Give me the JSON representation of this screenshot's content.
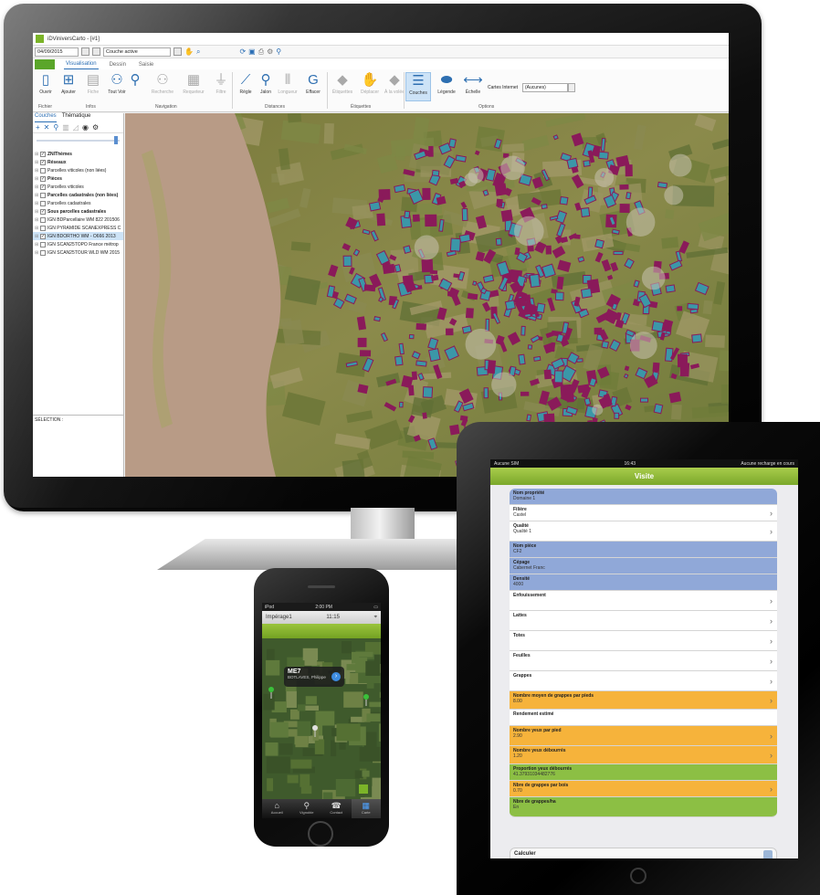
{
  "desktop": {
    "window_title": "iDViniversCarto - [#1]",
    "quickbar": {
      "date": "04/09/2015",
      "layer_combo": "Couche active"
    },
    "ribbon_tabs": [
      "Visualisation",
      "Dessin",
      "Saisie"
    ],
    "ribbon": {
      "buttons": {
        "ouvrir": "Ouvrir",
        "ajouter": "Ajouter",
        "fiche": "Fiche",
        "tout_voir": "Tout Voir",
        "recherche": "Recherche",
        "requeteur": "Requeteur",
        "filtre": "Filtre",
        "regle": "Règle",
        "jalon": "Jalon",
        "longueur": "Longueur",
        "effacer": "Effacer",
        "etiquettes": "Étiquettes",
        "deplacer": "Déplacer",
        "a_la_volee": "À la volée",
        "couches": "Couches",
        "legende": "Légende",
        "echelle": "Échelle"
      },
      "groups": {
        "fichier": "Fichier",
        "infos": "Infos",
        "navigation": "Navigation",
        "distances": "Distances",
        "etiquettes": "Étiquettes",
        "options": "Options"
      },
      "cartes_internet_label": "Cartes Internet",
      "cartes_internet_value": "(Aucunes)"
    },
    "left_panel": {
      "tabs": [
        "Couches",
        "Thématique"
      ],
      "layers": [
        {
          "name": "ZNIThèmes",
          "checked": true,
          "bold": true
        },
        {
          "name": "Réseaux",
          "checked": true,
          "bold": true
        },
        {
          "name": "Parcelles viticoles (non liées)",
          "checked": false,
          "bold": false
        },
        {
          "name": "Pièces",
          "checked": true,
          "bold": true
        },
        {
          "name": "Parcelles viticoles",
          "checked": true,
          "bold": false
        },
        {
          "name": "Parcelles cadastrales (non liées)",
          "checked": false,
          "bold": true
        },
        {
          "name": "Parcelles cadastrales",
          "checked": false,
          "bold": false
        },
        {
          "name": "Sous parcelles cadastrales",
          "checked": true,
          "bold": true
        },
        {
          "name": "IGN BDParcellaire WM 822 201506",
          "checked": false,
          "bold": false
        },
        {
          "name": "IGN PYRAMIDE SCANEXPRESS C",
          "checked": false,
          "bold": false
        },
        {
          "name": "IGN BDORTHO WM - O666 2013",
          "checked": true,
          "bold": false
        },
        {
          "name": "IGN SCAN25TOPO France métrop",
          "checked": false,
          "bold": false
        },
        {
          "name": "IGN SCAN25TOUR WLD WM 2015",
          "checked": false,
          "bold": false
        }
      ],
      "selection_label": "SÉLECTION :"
    },
    "colors": {
      "accent": "#2c6fb5",
      "file_tab": "#5aa62a",
      "parcel_fill": "#3b97a8",
      "parcel_stroke": "#8a1a5a"
    }
  },
  "phone": {
    "status": {
      "carrier": "iPod",
      "time": "2:00 PM"
    },
    "nav": {
      "left": "Impérage1",
      "time": "11:15"
    },
    "callout": {
      "title": "ME7",
      "subtitle": "BOTLAVES, Philippe"
    },
    "tabs": [
      {
        "label": "Accueil",
        "icon": "home-icon"
      },
      {
        "label": "Vignoble",
        "icon": "search-icon"
      },
      {
        "label": "Contact",
        "icon": "phone-icon"
      },
      {
        "label": "Carte",
        "icon": "map-icon"
      }
    ]
  },
  "tablet": {
    "status": {
      "carrier": "Aucune SIM",
      "time": "16:43",
      "charging": "Aucune recharge en cours"
    },
    "title": "Visite",
    "rows": [
      {
        "label": "Nom propriété",
        "value": "Domaine 1",
        "color": "blue",
        "chevron": false
      },
      {
        "label": "Filière",
        "value": "Castel",
        "color": "white",
        "chevron": true
      },
      {
        "label": "Qualité",
        "value": "Qualité 1",
        "color": "white",
        "chevron": true
      },
      {
        "label": "Nom pièce",
        "value": "CF2",
        "color": "blue",
        "chevron": false
      },
      {
        "label": "Cépage",
        "value": "Cabernet Franc",
        "color": "blue",
        "chevron": false
      },
      {
        "label": "Densité",
        "value": "4000",
        "color": "blue",
        "chevron": false
      },
      {
        "label": "Enfouissement",
        "value": "",
        "color": "white",
        "chevron": true
      },
      {
        "label": "Lattes",
        "value": "",
        "color": "white",
        "chevron": true
      },
      {
        "label": "Totes",
        "value": "",
        "color": "white",
        "chevron": true
      },
      {
        "label": "Feuilles",
        "value": "",
        "color": "white",
        "chevron": true
      },
      {
        "label": "Grappes",
        "value": "",
        "color": "white",
        "chevron": true
      },
      {
        "label": "Nombre moyen de grappes par pieds",
        "value": "8.00",
        "color": "orange",
        "chevron": true
      },
      {
        "label": "Rendement estimé",
        "value": "",
        "color": "white",
        "chevron": false
      },
      {
        "label": "Nombre yeux par pied",
        "value": "2.90",
        "color": "orange",
        "chevron": true
      },
      {
        "label": "Nombre yeux débourrés",
        "value": "1.20",
        "color": "orange",
        "chevron": true
      },
      {
        "label": "Proportion yeux débourrés",
        "value": "41.37931034482776",
        "color": "green",
        "chevron": false
      },
      {
        "label": "Nbre de grappes par bois",
        "value": "0.70",
        "color": "orange",
        "chevron": true
      },
      {
        "label": "Nbre de grappes/ha",
        "value": "En",
        "color": "green",
        "chevron": false
      }
    ],
    "calculate_label": "Calculer"
  }
}
